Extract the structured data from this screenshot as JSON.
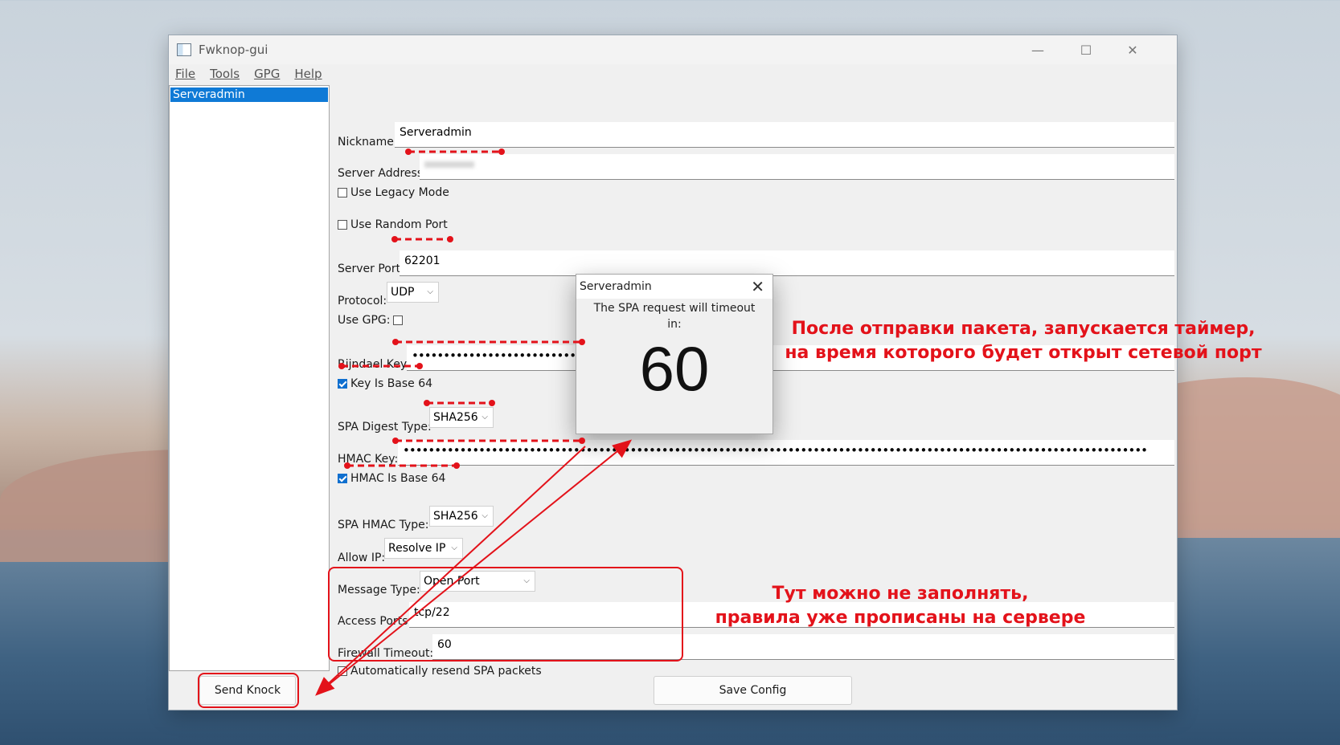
{
  "window": {
    "title": "Fwknop-gui",
    "controls": {
      "minimize": "—",
      "maximize": "☐",
      "close": "✕"
    }
  },
  "menu": [
    "File",
    "Tools",
    "GPG",
    "Help"
  ],
  "sidebar": {
    "items": [
      {
        "label": "Serveradmin",
        "selected": true
      }
    ]
  },
  "form": {
    "nickname": {
      "label": "Nickname:",
      "value": "Serveradmin"
    },
    "server_address": {
      "label": "Server Address:",
      "value": ""
    },
    "use_legacy_mode": {
      "label": "Use Legacy Mode",
      "checked": false
    },
    "use_random_port": {
      "label": "Use Random Port",
      "checked": false
    },
    "server_port": {
      "label": "Server Port:",
      "value": "62201"
    },
    "protocol": {
      "label": "Protocol:",
      "value": "UDP"
    },
    "use_gpg": {
      "label": "Use GPG:",
      "checked": false
    },
    "rijndael_key": {
      "label": "Rijndael Key:",
      "value": "•••••••••••••••••••••••••••••"
    },
    "key_is_base64": {
      "label": "Key Is Base 64",
      "checked": true
    },
    "spa_digest_type": {
      "label": "SPA Digest Type:",
      "value": "SHA256"
    },
    "hmac_key": {
      "label": "HMAC Key:",
      "value": "••••••••••••••••••••••••••••••••••••••••••••••••••••••••••••••••••••••••••••••••••••••••••••••••••••••••••••••••••••••"
    },
    "hmac_is_base64": {
      "label": "HMAC Is Base 64",
      "checked": true
    },
    "spa_hmac_type": {
      "label": "SPA HMAC Type:",
      "value": "SHA256"
    },
    "allow_ip": {
      "label": "Allow IP:",
      "value": "Resolve IP"
    },
    "message_type": {
      "label": "Message Type:",
      "value": "Open Port"
    },
    "access_ports": {
      "label": "Access Ports:",
      "value": "tcp/22"
    },
    "firewall_timeout": {
      "label": "Firewall Timeout:",
      "value": "60"
    },
    "auto_resend": {
      "label": "Automatically resend SPA packets",
      "checked": false
    }
  },
  "buttons": {
    "send_knock": "Send Knock",
    "save_config": "Save Config"
  },
  "dialog": {
    "title": "Serveradmin",
    "close": "✕",
    "message_line1": "The SPA request will timeout",
    "message_line2": "in:",
    "countdown": "60"
  },
  "annotations": {
    "timer_line1": "После отправки пакета, запускается таймер,",
    "timer_line2": "на время которого будет открыт сетевой порт",
    "optional_line1": "Тут можно не заполнять,",
    "optional_line2": "правила уже прописаны на сервере",
    "color": "#e3121a"
  }
}
